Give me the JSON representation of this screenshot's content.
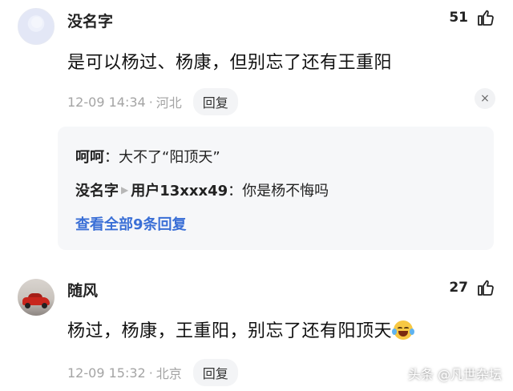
{
  "comments": [
    {
      "username": "没名字",
      "likes": "51",
      "text": "是可以杨过、杨康，但别忘了还有王重阳",
      "time": "12-09 14:34",
      "location": "河北",
      "reply_label": "回复",
      "close_glyph": "×"
    },
    {
      "username": "随风",
      "likes": "27",
      "text": "杨过，杨康，王重阳，别忘了还有阳顶天",
      "time": "12-09 15:32",
      "location": "北京",
      "reply_label": "回复"
    }
  ],
  "replies": [
    {
      "author": "呵呵",
      "text": "大不了“阳顶天”"
    },
    {
      "author": "没名字",
      "arrow": "▶",
      "target": "用户13xxx49",
      "text": "你是杨不悔吗"
    }
  ],
  "view_all": "查看全部9条回复",
  "separator": "·",
  "colon": "：",
  "watermark": "头条 @凡世杂坛"
}
